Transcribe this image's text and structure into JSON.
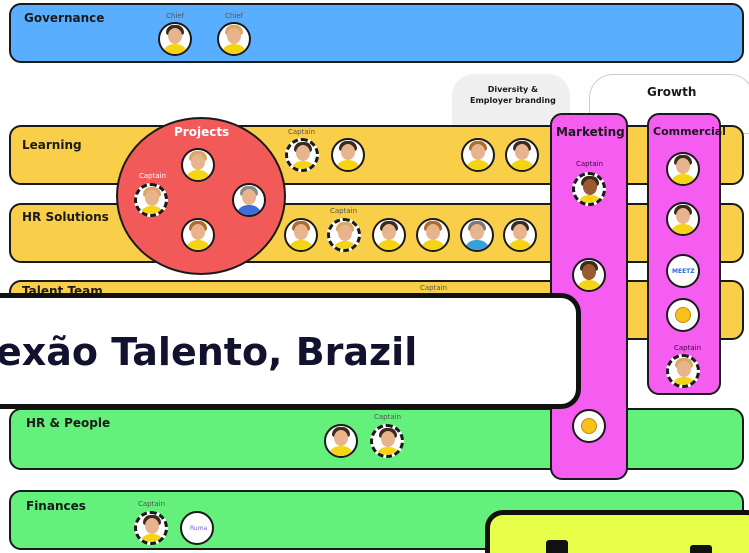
{
  "governance": {
    "label": "Governance",
    "roles": [
      "Chief",
      "Chief"
    ]
  },
  "bands": {
    "learning": "Learning",
    "hr_solutions": "HR Solutions",
    "talent_team": "Talent Team",
    "hr_people": "HR & People",
    "finances": "Finances"
  },
  "groups": {
    "projects": "Projects",
    "diversity": "Diversity &\nEmployer branding",
    "growth": "Growth",
    "marketing": "Marketing",
    "commercial": "Commercial"
  },
  "captain_label": "Captain",
  "logos": {
    "meetz": "MEETZ",
    "ruma": "Ruma"
  },
  "banner": {
    "title": "exão Talento, Brazil"
  },
  "colors": {
    "blue": "#5aaeff",
    "yellow": "#f9cf4a",
    "green": "#63f07b",
    "red": "#f25a5a",
    "magenta": "#f55cf0",
    "banner_yellow": "#e8ff4a"
  }
}
